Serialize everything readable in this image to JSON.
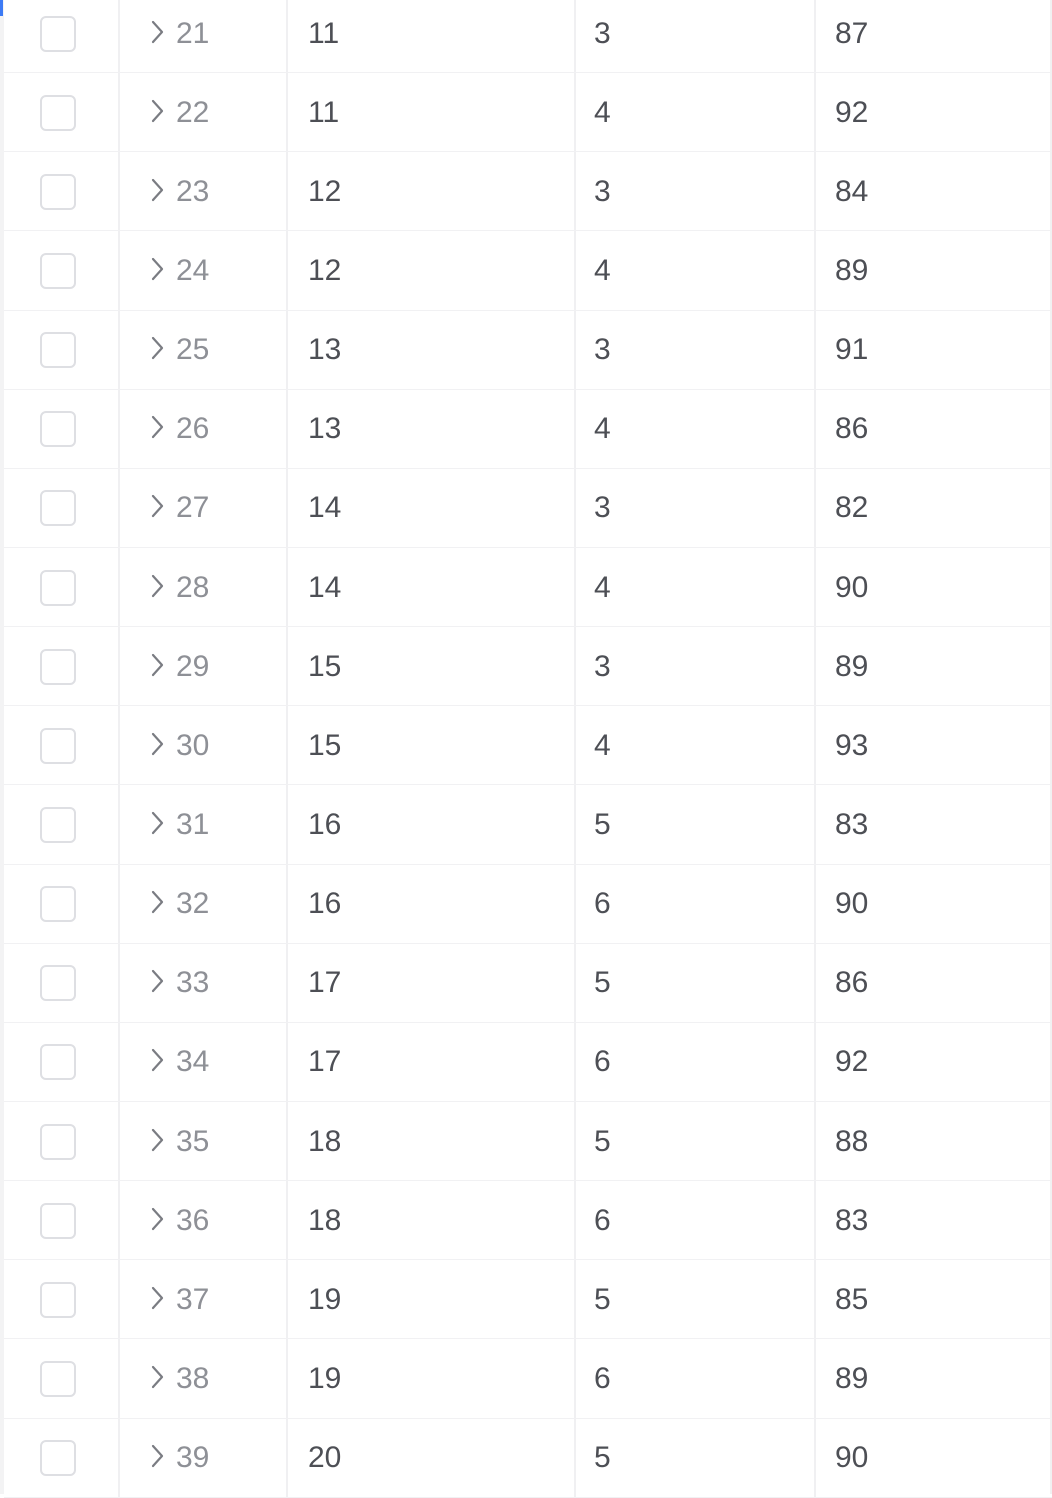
{
  "table": {
    "rows": [
      {
        "id": "21",
        "col_a": "11",
        "col_b": "3",
        "col_c": "87"
      },
      {
        "id": "22",
        "col_a": "11",
        "col_b": "4",
        "col_c": "92"
      },
      {
        "id": "23",
        "col_a": "12",
        "col_b": "3",
        "col_c": "84"
      },
      {
        "id": "24",
        "col_a": "12",
        "col_b": "4",
        "col_c": "89"
      },
      {
        "id": "25",
        "col_a": "13",
        "col_b": "3",
        "col_c": "91"
      },
      {
        "id": "26",
        "col_a": "13",
        "col_b": "4",
        "col_c": "86"
      },
      {
        "id": "27",
        "col_a": "14",
        "col_b": "3",
        "col_c": "82"
      },
      {
        "id": "28",
        "col_a": "14",
        "col_b": "4",
        "col_c": "90"
      },
      {
        "id": "29",
        "col_a": "15",
        "col_b": "3",
        "col_c": "89"
      },
      {
        "id": "30",
        "col_a": "15",
        "col_b": "4",
        "col_c": "93"
      },
      {
        "id": "31",
        "col_a": "16",
        "col_b": "5",
        "col_c": "83"
      },
      {
        "id": "32",
        "col_a": "16",
        "col_b": "6",
        "col_c": "90"
      },
      {
        "id": "33",
        "col_a": "17",
        "col_b": "5",
        "col_c": "86"
      },
      {
        "id": "34",
        "col_a": "17",
        "col_b": "6",
        "col_c": "92"
      },
      {
        "id": "35",
        "col_a": "18",
        "col_b": "5",
        "col_c": "88"
      },
      {
        "id": "36",
        "col_a": "18",
        "col_b": "6",
        "col_c": "83"
      },
      {
        "id": "37",
        "col_a": "19",
        "col_b": "5",
        "col_c": "85"
      },
      {
        "id": "38",
        "col_a": "19",
        "col_b": "6",
        "col_c": "89"
      },
      {
        "id": "39",
        "col_a": "20",
        "col_b": "5",
        "col_c": "90"
      }
    ]
  },
  "icons": {
    "expand": "chevron-right-icon",
    "select": "checkbox"
  },
  "colors": {
    "accent": "#3d7bf5",
    "text": "#4d4f55",
    "muted_text": "#8e9096",
    "border": "#f0f0f2"
  }
}
